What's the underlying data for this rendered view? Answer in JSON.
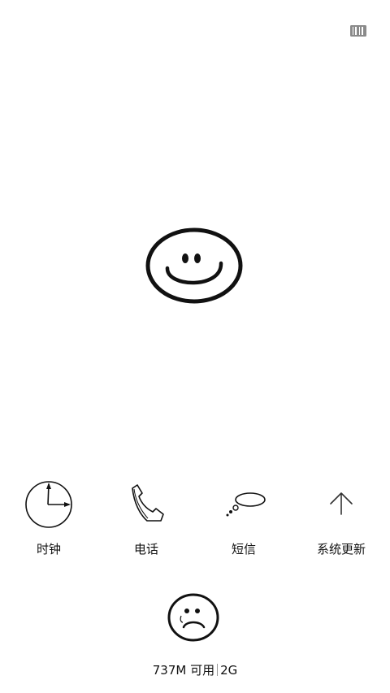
{
  "status": {
    "top_right_icon": "barcode-icon"
  },
  "center": {
    "face_icon": "smiley-face-icon"
  },
  "apps": [
    {
      "label": "时钟",
      "icon": "clock-icon"
    },
    {
      "label": "电话",
      "icon": "phone-icon"
    },
    {
      "label": "短信",
      "icon": "thought-bubble-icon"
    },
    {
      "label": "系统更新",
      "icon": "up-arrow-icon"
    }
  ],
  "cleanup": {
    "icon": "sad-face-icon"
  },
  "memory": {
    "available": "737M 可用",
    "total": "2G"
  }
}
